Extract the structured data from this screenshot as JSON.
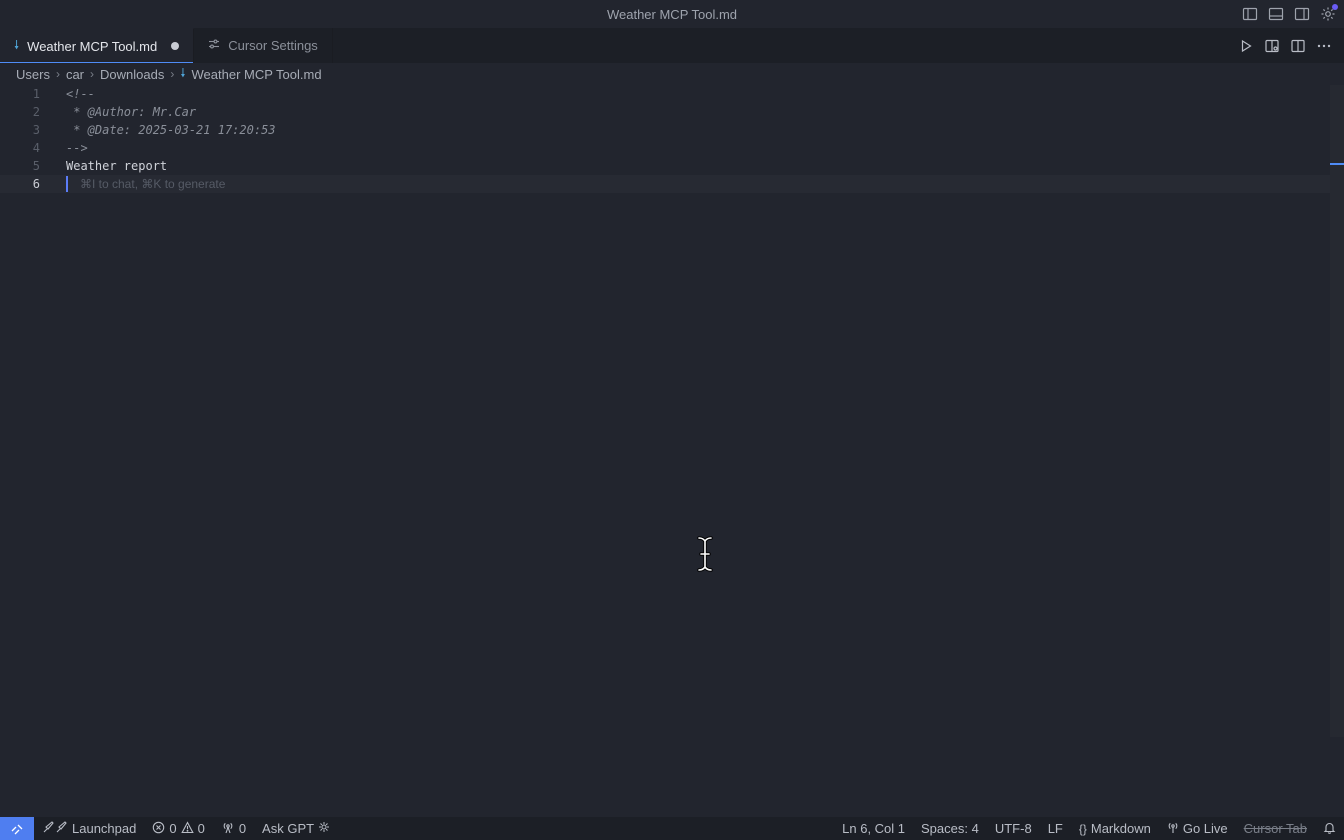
{
  "window": {
    "title": "Weather MCP Tool.md"
  },
  "tabs": [
    {
      "label": "Weather MCP Tool.md",
      "active": true,
      "modified": true
    },
    {
      "label": "Cursor Settings",
      "active": false
    }
  ],
  "breadcrumb": [
    "Users",
    "car",
    "Downloads",
    "Weather MCP Tool.md"
  ],
  "editor": {
    "lines": [
      {
        "no": "1",
        "text": "<!--"
      },
      {
        "no": "2",
        "text": " * @Author: Mr.Car"
      },
      {
        "no": "3",
        "text": " * @Date: 2025-03-21 17:20:53"
      },
      {
        "no": "4",
        "text": "-->"
      },
      {
        "no": "5",
        "text": "Weather report"
      },
      {
        "no": "6",
        "text": ""
      }
    ],
    "hint": "⌘I to chat, ⌘K to generate"
  },
  "statusbar": {
    "launchpad": "Launchpad",
    "errors": "0",
    "warnings": "0",
    "ports": "0",
    "ask_gpt": "Ask GPT",
    "position": "Ln 6, Col 1",
    "spaces": "Spaces: 4",
    "encoding": "UTF-8",
    "eol": "LF",
    "language": "Markdown",
    "go_live": "Go Live",
    "cursor_tab": "Cursor Tab"
  },
  "colors": {
    "accent": "#4f7ef0",
    "background": "#22252e",
    "badge": "#6a5cf5"
  }
}
